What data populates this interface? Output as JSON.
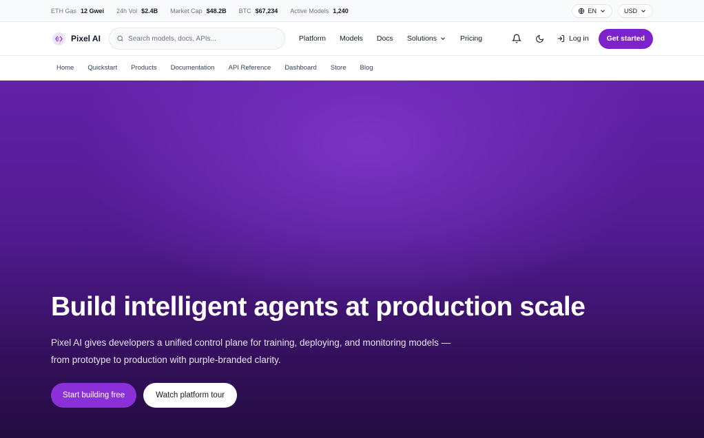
{
  "ticker": {
    "items": [
      {
        "label": "ETH Gas",
        "value": "12 Gwei"
      },
      {
        "label": "24h Vol",
        "value": "$2.4B"
      },
      {
        "label": "Market Cap",
        "value": "$48.2B"
      },
      {
        "label": "BTC",
        "value": "$67,234"
      },
      {
        "label": "Active Models",
        "value": "1,240"
      }
    ],
    "language": "EN",
    "currency": "USD"
  },
  "nav": {
    "brand": "Pixel AI",
    "search_placeholder": "Search models, docs, APIs...",
    "links": [
      "Platform",
      "Models",
      "Docs",
      "Solutions",
      "Pricing"
    ],
    "login": "Log in",
    "cta": "Get started"
  },
  "subnav": [
    "Home",
    "Quickstart",
    "Products",
    "Documentation",
    "API Reference",
    "Dashboard",
    "Store",
    "Blog"
  ],
  "hero": {
    "title": "Build intelligent agents at production scale",
    "subtitle": "Pixel AI gives developers a unified control plane for training, deploying, and monitoring models — from prototype to production with purple-branded clarity.",
    "primary_cta": "Start building free",
    "secondary_cta": "Watch platform tour"
  },
  "colors": {
    "accent": "#7e22ce",
    "hero_top": "#6322a9",
    "hero_bottom": "#230b3f"
  },
  "icons": [
    "globe-icon",
    "chevron-down-icon",
    "logo-icon",
    "search-icon",
    "bell-icon",
    "moon-icon",
    "login-icon"
  ]
}
